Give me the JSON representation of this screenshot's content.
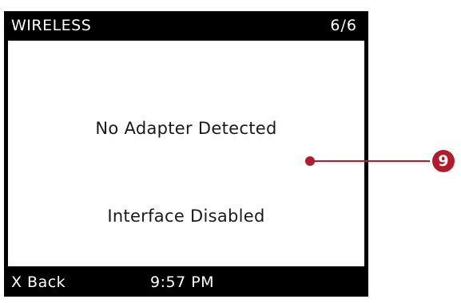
{
  "header": {
    "title": "WIRELESS",
    "page_indicator": "6/6"
  },
  "main": {
    "status_lines": [
      "No Adapter Detected",
      "Interface Disabled"
    ]
  },
  "footer": {
    "back_label": "X Back",
    "time": "9:57 PM"
  },
  "callout": {
    "number": "9",
    "color": "#b01c2e"
  }
}
